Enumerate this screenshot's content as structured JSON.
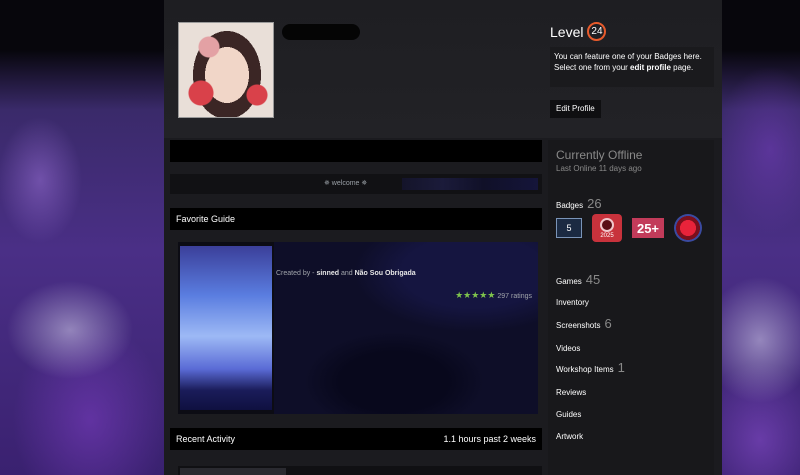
{
  "profile": {
    "level_label": "Level",
    "level": "24",
    "badge_hint_line1": "You can feature one of your Badges here.",
    "badge_hint_pre": "Select one from your ",
    "badge_hint_link": "edit profile",
    "badge_hint_post": " page.",
    "edit_button": "Edit Profile"
  },
  "showcase": {
    "welcome": "✵ welcome ✵"
  },
  "favorite_guide": {
    "heading": "Favorite Guide",
    "created_by_label": "Created by - ",
    "author1": "sinned",
    "and_label": " and ",
    "author2": "Não Sou Obrigada",
    "stars": "★★★★★",
    "ratings": "297 ratings"
  },
  "recent_activity": {
    "heading": "Recent Activity",
    "hours": "1.1 hours past 2 weeks"
  },
  "sidebar": {
    "status": "Currently Offline",
    "last_online": "Last Online 11 days ago",
    "badges_label": "Badges",
    "badges_count": "26",
    "badges": [
      {
        "name": "years-of-service-5",
        "text": "5"
      },
      {
        "name": "steam-2025",
        "text": "2025"
      },
      {
        "name": "25-plus",
        "text": "25+"
      },
      {
        "name": "red-emblem",
        "text": ""
      }
    ],
    "links": [
      {
        "label": "Games",
        "count": "45"
      },
      {
        "label": "Inventory",
        "count": ""
      },
      {
        "label": "Screenshots",
        "count": "6"
      },
      {
        "label": "Videos",
        "count": ""
      },
      {
        "label": "Workshop Items",
        "count": "1"
      },
      {
        "label": "Reviews",
        "count": ""
      },
      {
        "label": "Guides",
        "count": ""
      },
      {
        "label": "Artwork",
        "count": ""
      }
    ]
  }
}
